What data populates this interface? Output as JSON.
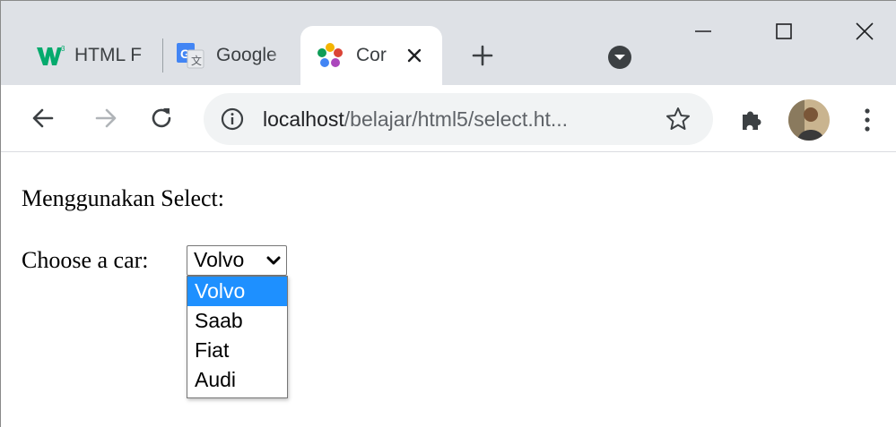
{
  "browser": {
    "tabs": [
      {
        "label": "HTML F",
        "icon": "w3schools-icon",
        "active": false
      },
      {
        "label": "Google",
        "icon": "google-translate-icon",
        "active": false
      },
      {
        "label": "Cor",
        "icon": "puzzle-flower-icon",
        "active": true
      }
    ],
    "address_bar": {
      "host": "localhost",
      "path": "/belajar/html5/select.ht..."
    },
    "colors": {
      "tabstrip_bg": "#dee1e6",
      "omnibox_bg": "#f1f3f4",
      "selection_blue": "#1e90ff"
    }
  },
  "page": {
    "heading": "Menggunakan Select:",
    "select_label": "Choose a car:",
    "select_value": "Volvo",
    "options": [
      "Volvo",
      "Saab",
      "Fiat",
      "Audi"
    ],
    "highlighted_option": "Volvo"
  }
}
